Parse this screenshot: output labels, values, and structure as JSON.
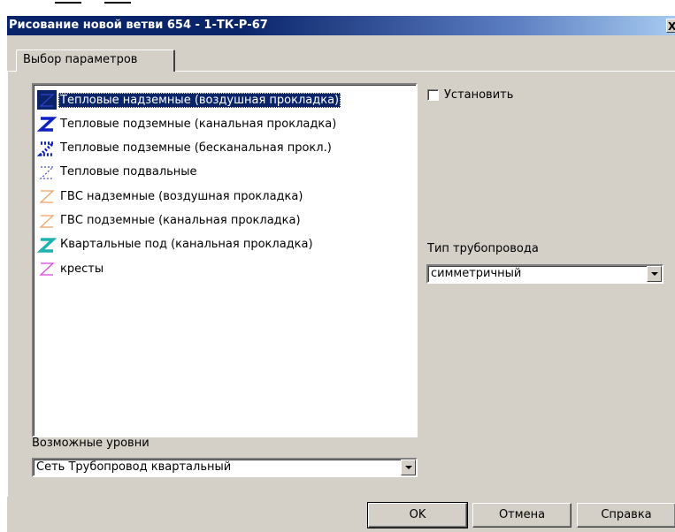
{
  "window": {
    "title": "Рисование новой ветви 654 - 1-ТК-Р-67",
    "close_glyph": "X"
  },
  "tab": {
    "label": "Выбор параметров"
  },
  "list": {
    "items": [
      {
        "label": "Тепловые надземные (воздушная прокладка)",
        "icon": "pipe-thin-blue-icon",
        "color": "#3040d0",
        "selected": true
      },
      {
        "label": "Тепловые подземные (канальная прокладка)",
        "icon": "pipe-bold-blue-icon",
        "color": "#1020c0",
        "selected": false
      },
      {
        "label": "Тепловые подземные (бесканальная прокл.)",
        "icon": "pipe-dotted-blue-icon",
        "color": "#1020c0",
        "selected": false
      },
      {
        "label": "Тепловые подвальные",
        "icon": "pipe-dashed-blue-icon",
        "color": "#4050d0",
        "selected": false
      },
      {
        "label": "ГВС надземные (воздушная прокладка)",
        "icon": "pipe-thin-orange-icon",
        "color": "#f0a060",
        "selected": false
      },
      {
        "label": "ГВС подземные (канальная прокладка)",
        "icon": "pipe-thin-orange-icon",
        "color": "#f0a060",
        "selected": false
      },
      {
        "label": "Квартальные под (канальная прокладка)",
        "icon": "pipe-bold-teal-icon",
        "color": "#20b0b0",
        "selected": false
      },
      {
        "label": "кресты",
        "icon": "pipe-thin-magenta-icon",
        "color": "#e040e0",
        "selected": false
      }
    ]
  },
  "checkbox": {
    "label": "Установить",
    "checked": false
  },
  "pipe_type": {
    "label": "Тип трубопровода",
    "value": "симметричный"
  },
  "levels": {
    "label": "Возможные уровни",
    "value": "Сеть Трубопровод квартальный"
  },
  "buttons": {
    "ok": "OK",
    "cancel": "Отмена",
    "help": "Справка"
  }
}
